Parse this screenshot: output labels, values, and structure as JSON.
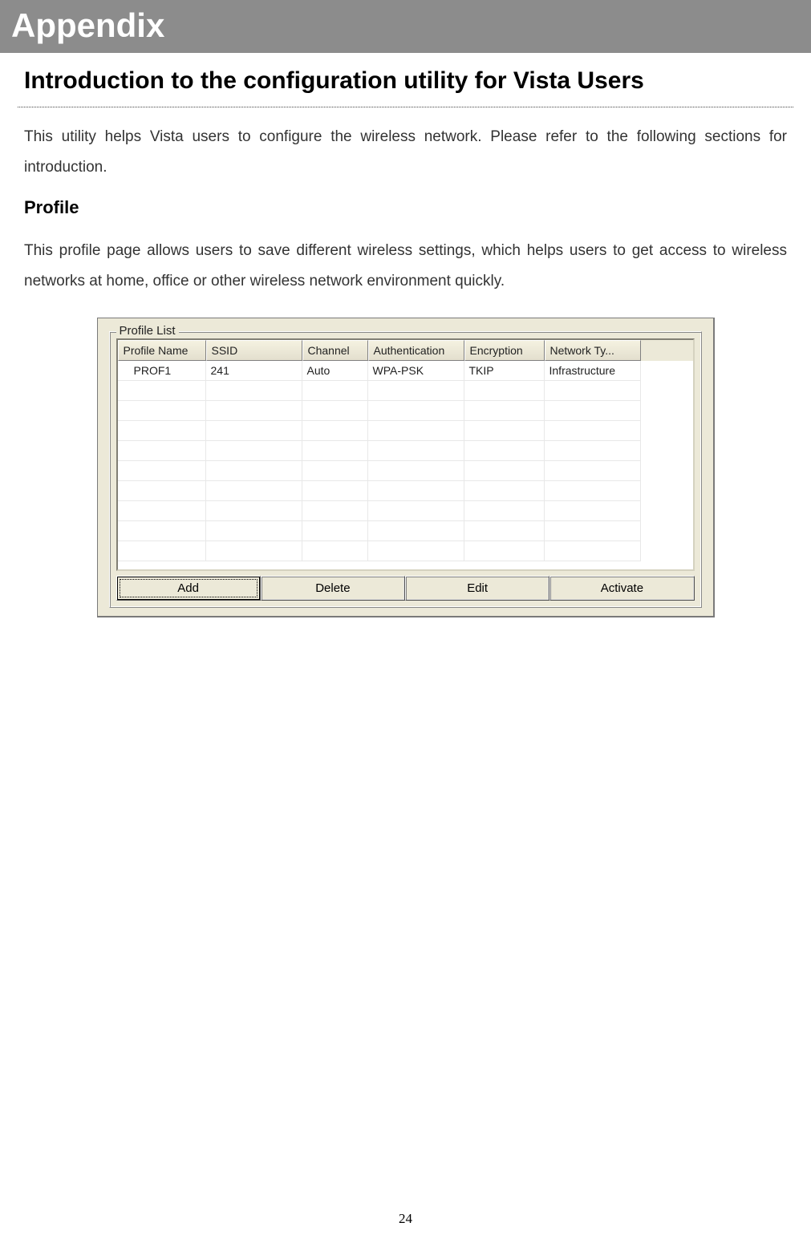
{
  "banner": {
    "title": "Appendix"
  },
  "section": {
    "title": "Introduction to the configuration utility for Vista Users",
    "intro": "This utility helps Vista users to configure the wireless network. Please refer to the following sections for introduction.",
    "profile_heading": "Profile",
    "profile_text": "This profile page allows users to save different wireless settings, which helps users to get access to wireless networks at home, office or other wireless network environment quickly."
  },
  "profile_panel": {
    "legend": "Profile List",
    "columns": [
      "Profile Name",
      "SSID",
      "Channel",
      "Authentication",
      "Encryption",
      "Network Ty..."
    ],
    "rows": [
      {
        "profile_name": "PROF1",
        "ssid": "241",
        "channel": "Auto",
        "authentication": "WPA-PSK",
        "encryption": "TKIP",
        "network_type": "Infrastructure"
      }
    ],
    "blank_rows": 9,
    "buttons": {
      "add": "Add",
      "delete": "Delete",
      "edit": "Edit",
      "activate": "Activate"
    }
  },
  "page_number": "24"
}
